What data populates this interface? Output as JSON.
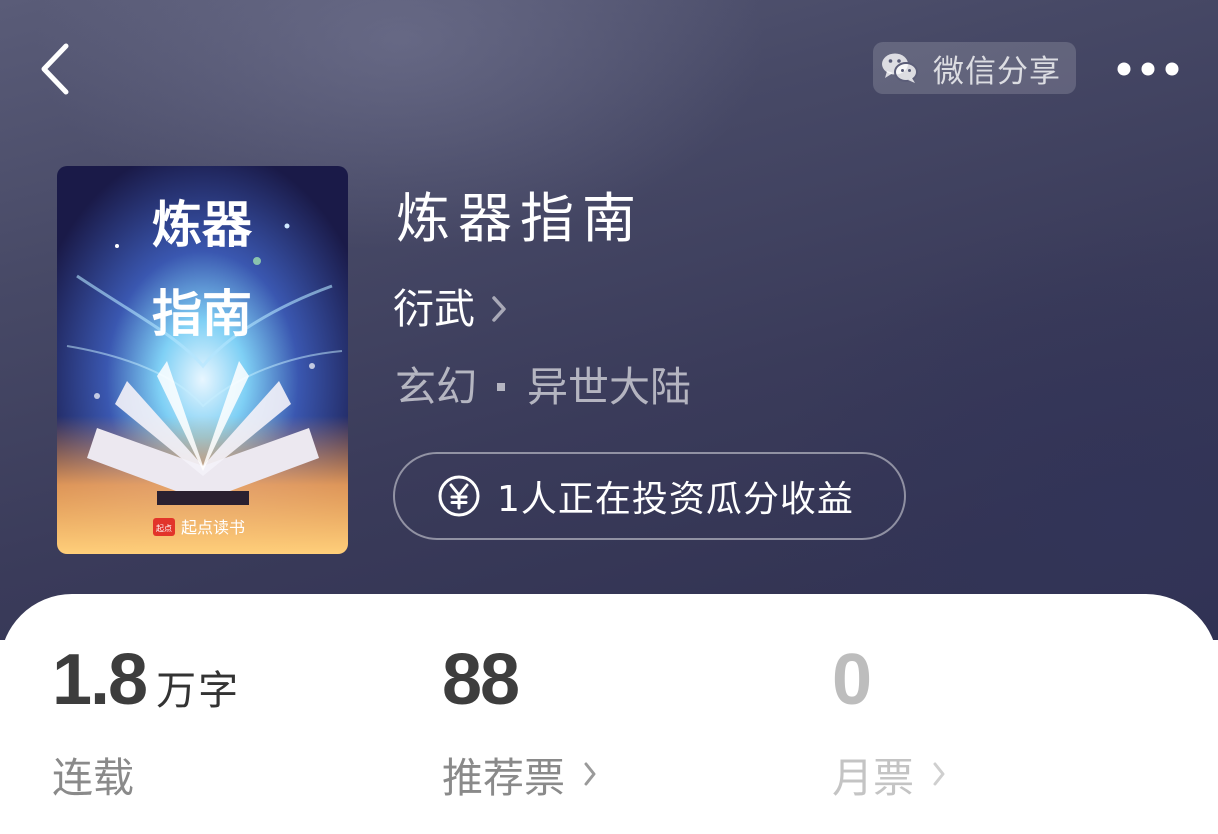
{
  "header": {
    "back_icon": "chevron-left-icon",
    "share_icon": "wechat-icon",
    "share_label": "微信分享",
    "more_icon": "more-dots-icon"
  },
  "book": {
    "title": "炼器指南",
    "author": "衍武",
    "category": "玄幻",
    "subcategory": "异世大陆",
    "cover": {
      "title_line1": "炼器",
      "title_line2": "指南",
      "publisher": "起点读书",
      "publisher_badge": "起点"
    }
  },
  "invest": {
    "icon": "yen-circle-icon",
    "label": "1人正在投资瓜分收益"
  },
  "stats": {
    "word_count": {
      "value": "1.8",
      "unit": "万字",
      "caption": "连载"
    },
    "recommend": {
      "value": "88",
      "caption": "推荐票"
    },
    "monthly": {
      "value": "0",
      "caption": "月票"
    }
  },
  "colors": {
    "hero_background": "#474966",
    "text_primary": "#ffffff",
    "stat_value": "#3d3d3d",
    "stat_caption": "#8a8a8a",
    "muted": "#bdbdbd"
  }
}
